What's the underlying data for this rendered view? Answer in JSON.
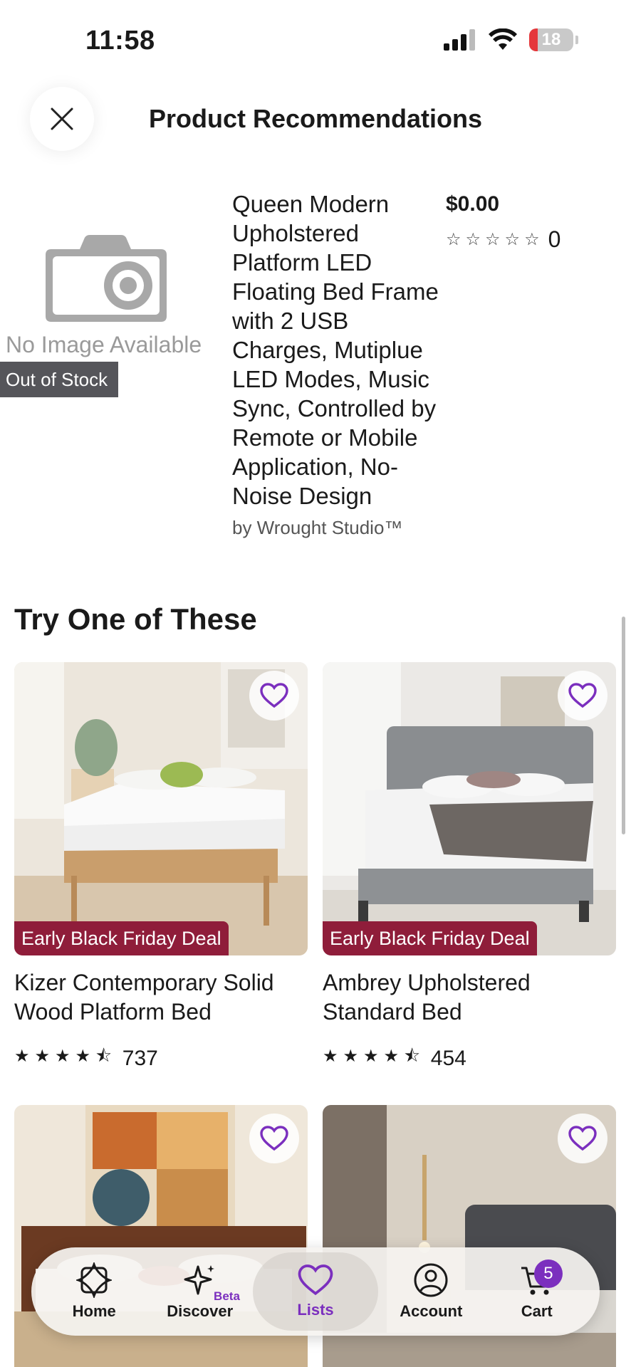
{
  "status_bar": {
    "time": "11:58",
    "battery": "18"
  },
  "header": {
    "title": "Product Recommendations"
  },
  "product": {
    "no_image_text": "No Image Available",
    "stock_badge": "Out of Stock",
    "title": "Queen Modern Upholstered Platform LED Floating Bed Frame with 2 USB Charges, Mutiplue LED Modes, Music Sync, Controlled by Remote or Mobile Application, No-Noise Design",
    "brand": "by Wrought Studio™",
    "price": "$0.00",
    "stars": "☆☆☆☆☆",
    "rating_count": "0"
  },
  "section": {
    "title": "Try One of These"
  },
  "cards": [
    {
      "title": "Kizer Contemporary Solid Wood Platform Bed",
      "badge": "Early Black Friday Deal",
      "stars": "★★★★⯪",
      "rating": 4.5,
      "count": "737"
    },
    {
      "title": "Ambrey Upholstered Standard Bed",
      "badge": "Early Black Friday Deal",
      "stars": "★★★★⯪",
      "rating": 4.5,
      "count": "454"
    }
  ],
  "bottom_nav": {
    "items": [
      {
        "label": "Home",
        "icon": "home-icon"
      },
      {
        "label": "Discover",
        "icon": "sparkle-icon",
        "badge": "Beta"
      },
      {
        "label": "Lists",
        "icon": "heart-icon",
        "active": true
      },
      {
        "label": "Account",
        "icon": "account-icon"
      },
      {
        "label": "Cart",
        "icon": "cart-icon",
        "count": "5"
      }
    ]
  },
  "colors": {
    "accent": "#7b2fbe",
    "deal": "#8f1d3a",
    "stock_badge": "#55555a"
  }
}
